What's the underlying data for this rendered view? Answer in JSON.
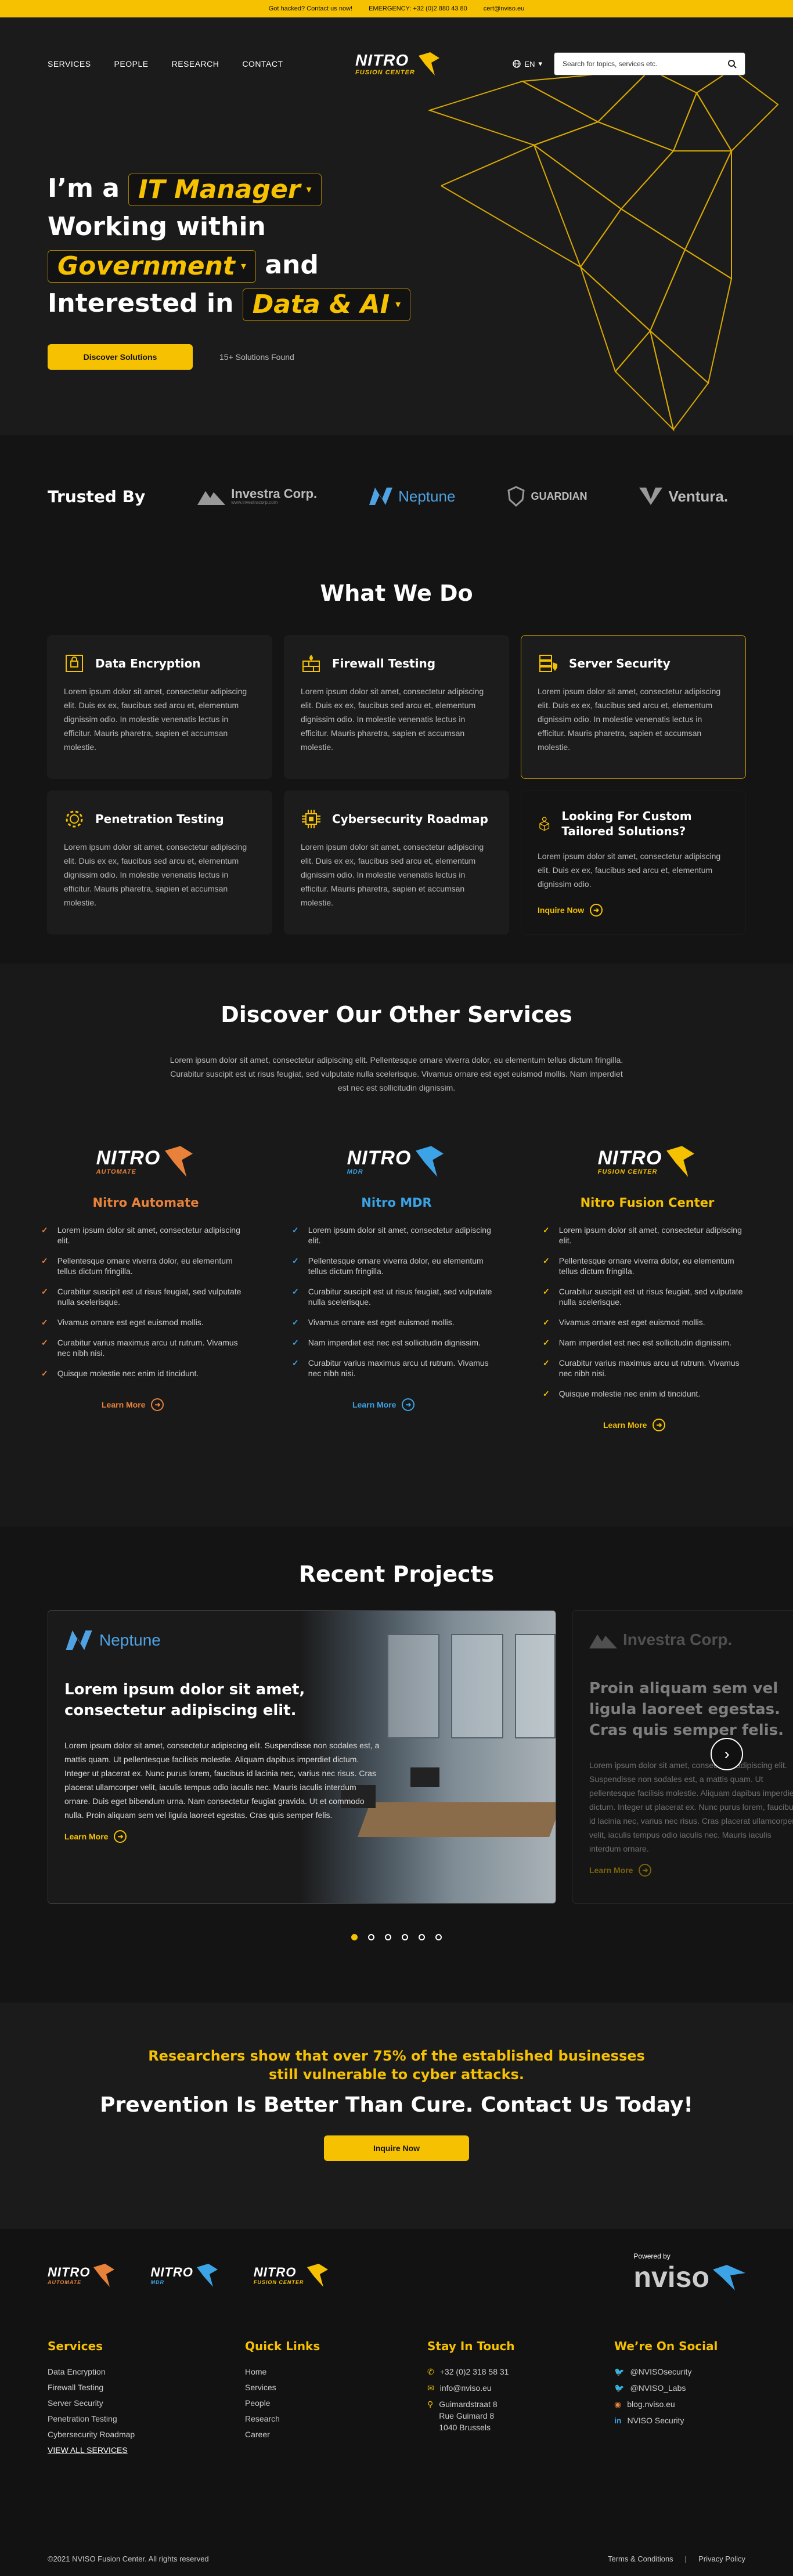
{
  "topbar": {
    "hacked": "Got hacked? Contact us now!",
    "emergency": "EMERGENCY: +32 (0)2 880 43 80",
    "email": "cert@nviso.eu"
  },
  "nav": {
    "items": [
      "SERVICES",
      "PEOPLE",
      "RESEARCH",
      "CONTACT"
    ],
    "logo_main": "NITRO",
    "logo_sub": "FUSION CENTER",
    "lang": "EN",
    "search_placeholder": "Search for topics, services etc."
  },
  "hero": {
    "im_a": "I’m a",
    "role": "IT Manager",
    "working_within": "Working within",
    "sector": "Government",
    "and": "and",
    "interested_in": "Interested in",
    "interest": "Data & AI",
    "discover_button": "Discover Solutions",
    "found": "15+ Solutions Found"
  },
  "trusted": {
    "title": "Trusted By",
    "brands": [
      "Investra Corp.",
      "Neptune",
      "GUARDIAN",
      "Ventura."
    ],
    "investra_tagline": "www.investracorp.com"
  },
  "what_we_do": {
    "title": "What We Do",
    "cards": [
      {
        "title": "Data Encryption",
        "text": "Lorem ipsum dolor sit amet, consectetur adipiscing elit. Duis ex ex, faucibus sed arcu et, elementum dignissim odio. In molestie venenatis lectus in efficitur. Mauris pharetra, sapien et accumsan molestie."
      },
      {
        "title": "Firewall Testing",
        "text": "Lorem ipsum dolor sit amet, consectetur adipiscing elit. Duis ex ex, faucibus sed arcu et, elementum dignissim odio. In molestie venenatis lectus in efficitur. Mauris pharetra, sapien et accumsan molestie."
      },
      {
        "title": "Server Security",
        "text": "Lorem ipsum dolor sit amet, consectetur adipiscing elit. Duis ex ex, faucibus sed arcu et, elementum dignissim odio. In molestie venenatis lectus in efficitur. Mauris pharetra, sapien et accumsan molestie."
      },
      {
        "title": "Penetration Testing",
        "text": "Lorem ipsum dolor sit amet, consectetur adipiscing elit. Duis ex ex, faucibus sed arcu et, elementum dignissim odio. In molestie venenatis lectus in efficitur. Mauris pharetra, sapien et accumsan molestie."
      },
      {
        "title": "Cybersecurity Roadmap",
        "text": "Lorem ipsum dolor sit amet, consectetur adipiscing elit. Duis ex ex, faucibus sed arcu et, elementum dignissim odio. In molestie venenatis lectus in efficitur. Mauris pharetra, sapien et accumsan molestie."
      },
      {
        "title": "Looking For Custom Tailored Solutions?",
        "text": "Lorem ipsum dolor sit amet, consectetur adipiscing elit. Duis ex ex, faucibus sed arcu et, elementum dignissim odio.",
        "link": "Inquire Now"
      }
    ]
  },
  "services": {
    "title": "Discover Our Other Services",
    "intro": "Lorem ipsum dolor sit amet, consectetur adipiscing elit. Pellentesque ornare viverra dolor, eu elementum tellus dictum fringilla. Curabitur suscipit est ut risus feugiat, sed vulputate nulla scelerisque. Vivamus ornare est eget euismod mollis. Nam imperdiet est nec est sollicitudin dignissim.",
    "products": [
      {
        "name": "Nitro Automate",
        "logo_sub": "AUTOMATE",
        "color": "#e8823a",
        "items": [
          "Lorem ipsum dolor sit amet, consectetur adipiscing elit.",
          "Pellentesque ornare viverra dolor, eu elementum tellus dictum fringilla.",
          "Curabitur suscipit est ut risus feugiat, sed vulputate nulla scelerisque.",
          "Vivamus ornare est eget euismod mollis.",
          "Curabitur varius maximus arcu ut rutrum. Vivamus nec nibh nisi.",
          "Quisque molestie nec enim id tincidunt."
        ],
        "more": "Learn More"
      },
      {
        "name": "Nitro MDR",
        "logo_sub": "MDR",
        "color": "#3ba3e6",
        "items": [
          "Lorem ipsum dolor sit amet, consectetur adipiscing elit.",
          "Pellentesque ornare viverra dolor, eu elementum tellus dictum fringilla.",
          "Curabitur suscipit est ut risus feugiat, sed vulputate nulla scelerisque.",
          "Vivamus ornare est eget euismod mollis.",
          "Nam imperdiet est nec est sollicitudin dignissim.",
          "Curabitur varius maximus arcu ut rutrum. Vivamus nec nibh nisi."
        ],
        "more": "Learn More"
      },
      {
        "name": "Nitro Fusion Center",
        "logo_sub": "FUSION CENTER",
        "color": "#f6c100",
        "items": [
          "Lorem ipsum dolor sit amet, consectetur adipiscing elit.",
          "Pellentesque ornare viverra dolor, eu elementum tellus dictum fringilla.",
          "Curabitur suscipit est ut risus feugiat, sed vulputate nulla scelerisque.",
          "Vivamus ornare est eget euismod mollis.",
          "Nam imperdiet est nec est sollicitudin dignissim.",
          "Curabitur varius maximus arcu ut rutrum. Vivamus nec nibh nisi.",
          "Quisque molestie nec enim id tincidunt."
        ],
        "more": "Learn More"
      }
    ]
  },
  "projects": {
    "title": "Recent Projects",
    "slide1": {
      "brand": "Neptune",
      "heading": "Lorem ipsum dolor sit amet, consectetur adipiscing elit.",
      "text": "Lorem ipsum dolor sit amet, consectetur adipiscing elit. Suspendisse non sodales est, a mattis quam. Ut pellentesque facilisis molestie. Aliquam dapibus imperdiet dictum. Integer ut placerat ex. Nunc purus lorem, faucibus id lacinia nec, varius nec risus. Cras placerat ullamcorper velit, iaculis tempus odio iaculis nec. Mauris iaculis interdum ornare. Duis eget bibendum urna. Nam consectetur feugiat gravida. Ut et commodo nulla. Proin aliquam sem vel ligula laoreet egestas. Cras quis semper felis.",
      "more": "Learn More"
    },
    "slide2": {
      "brand": "Investra Corp.",
      "heading": "Proin aliquam sem vel ligula laoreet egestas. Cras quis semper felis.",
      "text": "Lorem ipsum dolor sit amet, consectetur adipiscing elit. Suspendisse non sodales est, a mattis quam. Ut pellentesque facilisis molestie. Aliquam dapibus imperdiet dictum. Integer ut placerat ex. Nunc purus lorem, faucibus id lacinia nec, varius nec risus. Cras placerat ullamcorper velit, iaculis tempus odio iaculis nec. Mauris iaculis interdum ornare.",
      "more": "Learn More"
    },
    "dots": 6
  },
  "cta": {
    "stat": "Researchers show that over 75% of the established businesses still vulnerable to cyber attacks.",
    "headline": "Prevention Is Better Than Cure. Contact Us Today!",
    "button": "Inquire Now"
  },
  "footer": {
    "logos": [
      {
        "main": "NITRO",
        "sub": "AUTOMATE",
        "color": "#e8823a"
      },
      {
        "main": "NITRO",
        "sub": "MDR",
        "color": "#3ba3e6"
      },
      {
        "main": "NITRO",
        "sub": "FUSION CENTER",
        "color": "#f6c100"
      }
    ],
    "powered_by": "Powered by",
    "powered_brand": "nviso",
    "services_title": "Services",
    "services": [
      "Data Encryption",
      "Firewall Testing",
      "Server Security",
      "Penetration Testing",
      "Cybersecurity Roadmap"
    ],
    "view_all": "VIEW ALL SERVICES",
    "quick_title": "Quick Links",
    "quick": [
      "Home",
      "Services",
      "People",
      "Research",
      "Career"
    ],
    "touch_title": "Stay In Touch",
    "phone": "+32 (0)2 318 58 31",
    "email": "info@nviso.eu",
    "address1": "Guimardstraat 8",
    "address2": "Rue Guimard 8",
    "address3": "1040 Brussels",
    "social_title": "We’re On Social",
    "social": [
      "@NVISOsecurity",
      "@NVISO_Labs",
      "blog.nviso.eu",
      "NVISO Security"
    ],
    "copyright": "©2021 NVISO Fusion Center. All rights reserved",
    "terms": "Terms & Conditions",
    "privacy": "Privacy Policy"
  }
}
